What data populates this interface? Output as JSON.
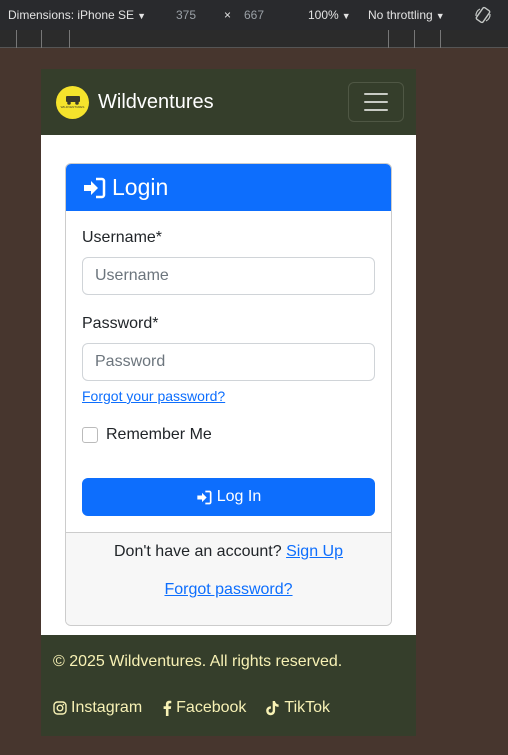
{
  "devtools": {
    "device": "Dimensions: iPhone SE",
    "width": "375",
    "times": "×",
    "height": "667",
    "zoom": "100%",
    "throttling": "No throttling"
  },
  "navbar": {
    "brand": "Wildventures",
    "logo_text": "WILDVENTURES"
  },
  "login": {
    "title": "Login",
    "username_label": "Username*",
    "username_placeholder": "Username",
    "password_label": "Password*",
    "password_placeholder": "Password",
    "forgot_link": "Forgot your password?",
    "remember_label": "Remember Me",
    "submit_label": "Log In"
  },
  "card_footer": {
    "no_account_text": "Don't have an account?",
    "signup_link": "Sign Up",
    "forgot_link": "Forgot password?"
  },
  "footer": {
    "copyright": "© 2025 Wildventures. All rights reserved.",
    "social": [
      {
        "label": "Instagram",
        "icon": "instagram-icon"
      },
      {
        "label": "Facebook",
        "icon": "facebook-icon"
      },
      {
        "label": "TikTok",
        "icon": "tiktok-icon"
      }
    ]
  },
  "colors": {
    "navbar": "#353e2b",
    "primary": "#0d6efd",
    "footer_text": "#f7f1b5",
    "page_bg": "#47362e"
  }
}
